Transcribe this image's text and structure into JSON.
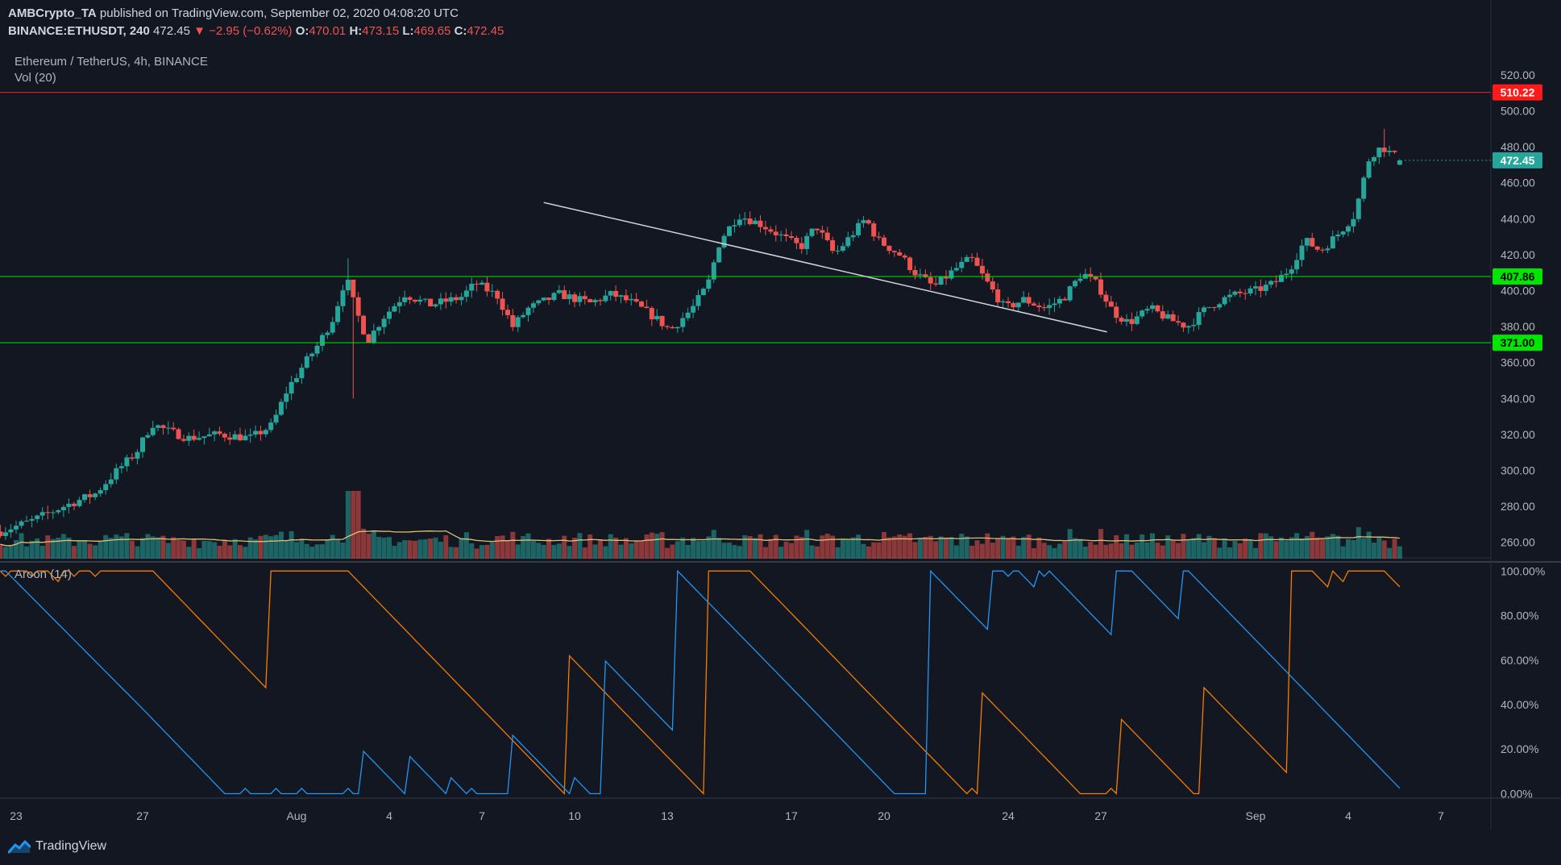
{
  "header": {
    "publisher": "AMBCrypto_TA",
    "published_text": "published on TradingView.com, September 02, 2020 04:08:20 UTC",
    "symbol": "BINANCE:ETHUSDT, 240",
    "last": "472.45",
    "change_arrow": "▼",
    "change": "−2.95 (−0.62%)",
    "o_label": "O:",
    "o": "470.01",
    "h_label": "H:",
    "h": "473.15",
    "l_label": "L:",
    "l": "469.65",
    "c_label": "C:",
    "c": "472.45"
  },
  "pane_title": "Ethereum / TetherUS, 4h, BINANCE",
  "volume_label": "Vol (20)",
  "aroon_label": "Aroon (14)",
  "footer": {
    "brand": "TradingView"
  },
  "colors": {
    "background": "#131722",
    "up": "#26a69a",
    "down": "#ef5350",
    "aroon_up": "#f57c00",
    "aroon_down": "#2196f3",
    "volume_ma": "#e0c070",
    "support": "#00e600",
    "resistance": "#ff1a1a",
    "trendline": "#d1d4dc"
  },
  "chart_data": [
    {
      "type": "candlestick",
      "x_axis": {
        "ticks": [
          "23",
          "27",
          "Aug",
          "4",
          "7",
          "10",
          "13",
          "17",
          "20",
          "24",
          "27",
          "Sep",
          "4",
          "7"
        ]
      },
      "y_axis": {
        "range": [
          250,
          528
        ],
        "ticks": [
          "260.00",
          "280.00",
          "300.00",
          "320.00",
          "340.00",
          "360.00",
          "380.00",
          "400.00",
          "420.00",
          "440.00",
          "460.00",
          "480.00",
          "500.00",
          "520.00"
        ]
      },
      "levels": [
        {
          "label": "510.22",
          "value": 510.22,
          "role": "resistance"
        },
        {
          "label": "407.86",
          "value": 407.86,
          "role": "support"
        },
        {
          "label": "371.00",
          "value": 371.0,
          "role": "support"
        }
      ],
      "last_price": {
        "label": "472.45",
        "value": 472.45
      },
      "trendline": {
        "from": {
          "day": 17.0,
          "price": 449
        },
        "to": {
          "day": 35.2,
          "price": 377
        }
      },
      "price_path": [
        [
          -0.5,
          266
        ],
        [
          0.5,
          272
        ],
        [
          1.5,
          280
        ],
        [
          2.5,
          287
        ],
        [
          3.2,
          300
        ],
        [
          3.8,
          310
        ],
        [
          4.3,
          326
        ],
        [
          4.8,
          322
        ],
        [
          5.5,
          318
        ],
        [
          6.5,
          320
        ],
        [
          7.5,
          318
        ],
        [
          8.2,
          325
        ],
        [
          8.7,
          345
        ],
        [
          9.2,
          358
        ],
        [
          9.7,
          370
        ],
        [
          10.2,
          385
        ],
        [
          10.6,
          408
        ],
        [
          10.9,
          390
        ],
        [
          11.3,
          372
        ],
        [
          11.8,
          385
        ],
        [
          12.5,
          398
        ],
        [
          13.3,
          392
        ],
        [
          14.3,
          396
        ],
        [
          14.8,
          404
        ],
        [
          15.5,
          397
        ],
        [
          16.0,
          380
        ],
        [
          16.5,
          390
        ],
        [
          17.5,
          398
        ],
        [
          18.5,
          393
        ],
        [
          19.2,
          398
        ],
        [
          19.9,
          393
        ],
        [
          20.6,
          385
        ],
        [
          21.1,
          378
        ],
        [
          21.8,
          390
        ],
        [
          22.3,
          403
        ],
        [
          22.7,
          428
        ],
        [
          23.3,
          442
        ],
        [
          24.0,
          437
        ],
        [
          24.7,
          430
        ],
        [
          25.3,
          424
        ],
        [
          25.8,
          436
        ],
        [
          26.4,
          420
        ],
        [
          27.0,
          432
        ],
        [
          27.4,
          440
        ],
        [
          27.8,
          428
        ],
        [
          28.5,
          420
        ],
        [
          29.0,
          410
        ],
        [
          29.6,
          402
        ],
        [
          30.3,
          412
        ],
        [
          30.8,
          418
        ],
        [
          31.3,
          405
        ],
        [
          31.9,
          390
        ],
        [
          32.5,
          395
        ],
        [
          33.2,
          390
        ],
        [
          33.8,
          396
        ],
        [
          34.4,
          410
        ],
        [
          34.9,
          403
        ],
        [
          35.4,
          388
        ],
        [
          35.9,
          382
        ],
        [
          36.6,
          390
        ],
        [
          37.2,
          384
        ],
        [
          37.8,
          380
        ],
        [
          38.4,
          390
        ],
        [
          38.9,
          395
        ],
        [
          39.4,
          398
        ],
        [
          40.0,
          400
        ],
        [
          40.6,
          404
        ],
        [
          41.1,
          412
        ],
        [
          41.6,
          428
        ],
        [
          42.1,
          422
        ],
        [
          42.7,
          432
        ],
        [
          43.2,
          442
        ],
        [
          43.7,
          475
        ],
        [
          44.1,
          480
        ],
        [
          44.4,
          476
        ],
        [
          44.7,
          472.45
        ]
      ],
      "volume_scale_max": 300
    },
    {
      "type": "line",
      "name": "Aroon (14)",
      "series": [
        {
          "name": "Aroon Up"
        },
        {
          "name": "Aroon Down"
        }
      ],
      "y_axis": {
        "range": [
          -2,
          103
        ],
        "ticks": [
          {
            "label": "100.00%",
            "value": 100
          },
          {
            "label": "80.00%",
            "value": 80
          },
          {
            "label": "60.00%",
            "value": 60
          },
          {
            "label": "40.00%",
            "value": 40
          },
          {
            "label": "20.00%",
            "value": 20
          },
          {
            "label": "0.00%",
            "value": 0
          }
        ]
      }
    }
  ]
}
